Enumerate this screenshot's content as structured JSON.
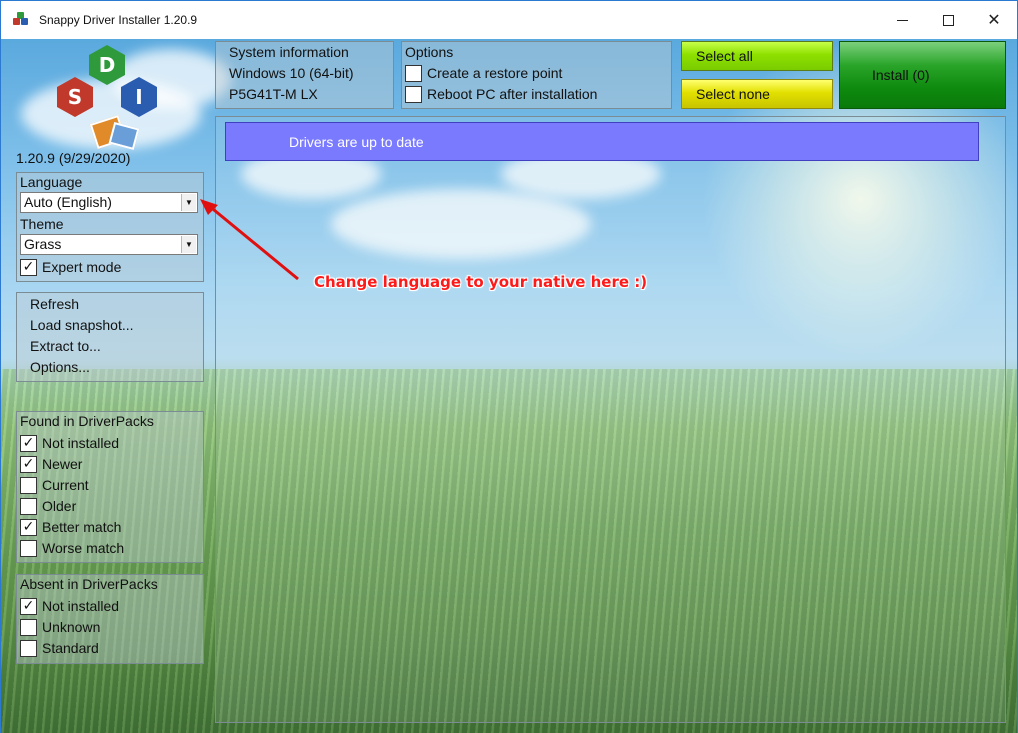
{
  "titlebar": {
    "title": "Snappy Driver Installer 1.20.9",
    "minimize_icon": "minimize-icon",
    "maximize_icon": "maximize-icon",
    "close_icon": "close-icon"
  },
  "logo": {
    "letters": [
      "D",
      "S",
      "I"
    ],
    "colors": [
      "#2e9a3c",
      "#c0392b",
      "#2a5db0"
    ],
    "version": "1.20.9 (9/29/2020)"
  },
  "language_panel": {
    "language_label": "Language",
    "language_value": "Auto (English)",
    "theme_label": "Theme",
    "theme_value": "Grass",
    "expert_mode_label": "Expert mode",
    "expert_mode_checked": true
  },
  "menu_panel": {
    "items": [
      "Refresh",
      "Load snapshot...",
      "Extract to...",
      "Options..."
    ]
  },
  "found_panel": {
    "title": "Found in DriverPacks",
    "items": [
      {
        "label": "Not installed",
        "checked": true
      },
      {
        "label": "Newer",
        "checked": true
      },
      {
        "label": "Current",
        "checked": false
      },
      {
        "label": "Older",
        "checked": false
      },
      {
        "label": "Better match",
        "checked": true
      },
      {
        "label": "Worse match",
        "checked": false
      }
    ]
  },
  "absent_panel": {
    "title": "Absent in DriverPacks",
    "items": [
      {
        "label": "Not installed",
        "checked": true
      },
      {
        "label": "Unknown",
        "checked": false
      },
      {
        "label": "Standard",
        "checked": false
      }
    ]
  },
  "system_info": {
    "title": "System information",
    "os": "Windows 10 (64-bit)",
    "board": "P5G41T-M LX"
  },
  "options": {
    "title": "Options",
    "restore_point_label": "Create a restore point",
    "restore_point_checked": false,
    "reboot_label": "Reboot PC after installation",
    "reboot_checked": false
  },
  "actions": {
    "select_all": "Select all",
    "select_none": "Select none",
    "install": "Install (0)"
  },
  "status": {
    "message": "Drivers are up to date"
  },
  "annotation": {
    "text": "Change language to your native here :)",
    "color": "#ff1a1a"
  }
}
